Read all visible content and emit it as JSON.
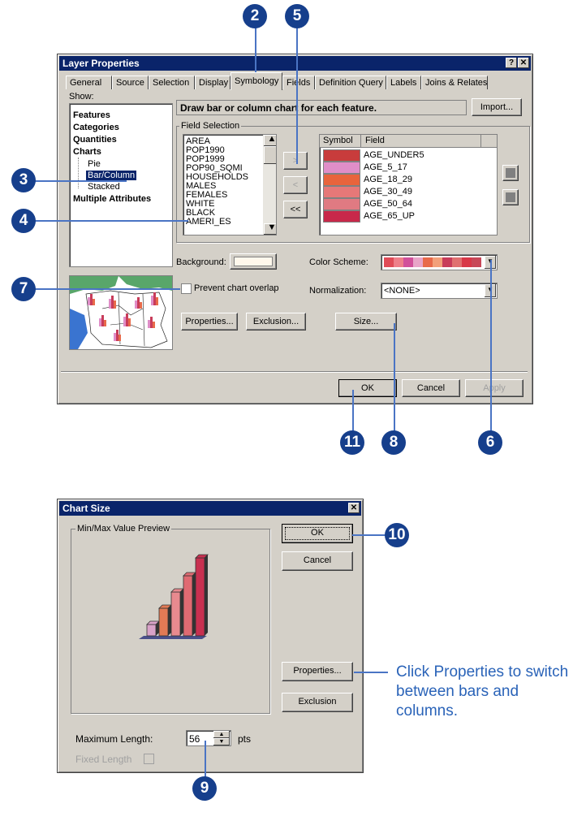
{
  "layer_properties": {
    "title": "Layer Properties",
    "title_buttons": {
      "help": "?",
      "close": "✕"
    },
    "tabs": [
      "General",
      "Source",
      "Selection",
      "Display",
      "Symbology",
      "Fields",
      "Definition Query",
      "Labels",
      "Joins & Relates"
    ],
    "active_tab": "Symbology",
    "show_label": "Show:",
    "show_tree": {
      "features": "Features",
      "categories": "Categories",
      "quantities": "Quantities",
      "charts": "Charts",
      "pie": "Pie",
      "bar_column": "Bar/Column",
      "stacked": "Stacked",
      "multiple": "Multiple Attributes"
    },
    "description": "Draw bar or column chart for each feature.",
    "import_button": "Import...",
    "field_selection_label": "Field Selection",
    "available_fields": [
      "AREA",
      "POP1990",
      "POP1999",
      "POP90_SQMI",
      "HOUSEHOLDS",
      "MALES",
      "FEMALES",
      "WHITE",
      "BLACK",
      "AMERI_ES"
    ],
    "move_buttons": {
      "add": ">",
      "remove": "<",
      "remove_all": "<<"
    },
    "symbol_header": "Symbol",
    "field_header": "Field",
    "selected_fields": [
      {
        "field": "AGE_UNDER5",
        "color": "#c83c3c"
      },
      {
        "field": "AGE_5_17",
        "color": "#e08ec8"
      },
      {
        "field": "AGE_18_29",
        "color": "#e8643c"
      },
      {
        "field": "AGE_30_49",
        "color": "#e67878"
      },
      {
        "field": "AGE_50_64",
        "color": "#e07a82"
      },
      {
        "field": "AGE_65_UP",
        "color": "#c8284a"
      }
    ],
    "background_label": "Background:",
    "background_color": "#fff8ec",
    "color_scheme_label": "Color Scheme:",
    "color_scheme": [
      "#e04b57",
      "#ee7f8a",
      "#d1509a",
      "#e8a5c8",
      "#e86a4a",
      "#f2a07a",
      "#c83c5a",
      "#e07070",
      "#d83848",
      "#c84858"
    ],
    "prevent_overlap_label": "Prevent chart overlap",
    "normalization_label": "Normalization:",
    "normalization_value": "<NONE>",
    "properties_button": "Properties...",
    "exclusion_button": "Exclusion...",
    "size_button": "Size...",
    "ok_button": "OK",
    "cancel_button": "Cancel",
    "apply_button": "Apply"
  },
  "chart_size": {
    "title": "Chart Size",
    "close": "✕",
    "preview_label": "Min/Max Value Preview",
    "ok_button": "OK",
    "cancel_button": "Cancel",
    "properties_button": "Properties...",
    "exclusion_button": "Exclusion",
    "max_length_label": "Maximum Length:",
    "max_length_value": "56",
    "units": "pts",
    "fixed_length_label": "Fixed Length",
    "preview_bar_colors": [
      "#d9a2c8",
      "#e27a55",
      "#e88a8f",
      "#e06a72",
      "#c83050"
    ]
  },
  "callouts": [
    "2",
    "5",
    "3",
    "4",
    "7",
    "11",
    "8",
    "6",
    "10",
    "9"
  ],
  "caption": "Click Properties to switch between bars and columns.",
  "accent": "#163f8c"
}
